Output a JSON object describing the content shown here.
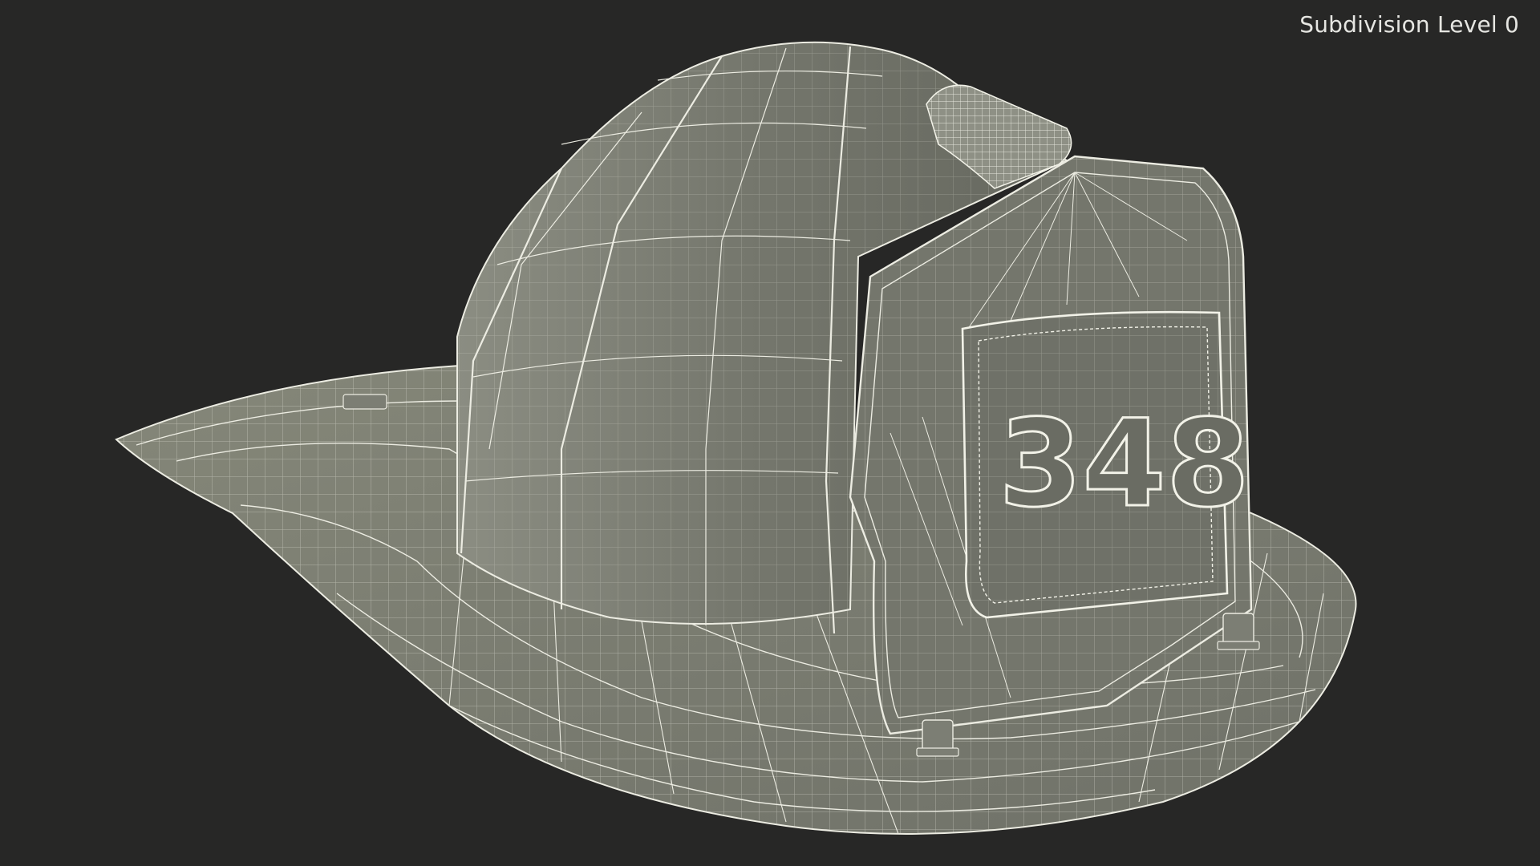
{
  "viewport": {
    "overlay_label": "Subdivision Level 0"
  },
  "model": {
    "badge_text": "348"
  },
  "colors": {
    "background": "#272726",
    "surface": "#7a7c72",
    "surface_light": "#8a8c82",
    "surface_dark": "#5f6158",
    "wire": "#ecece2",
    "label": "#e6e6e2"
  }
}
